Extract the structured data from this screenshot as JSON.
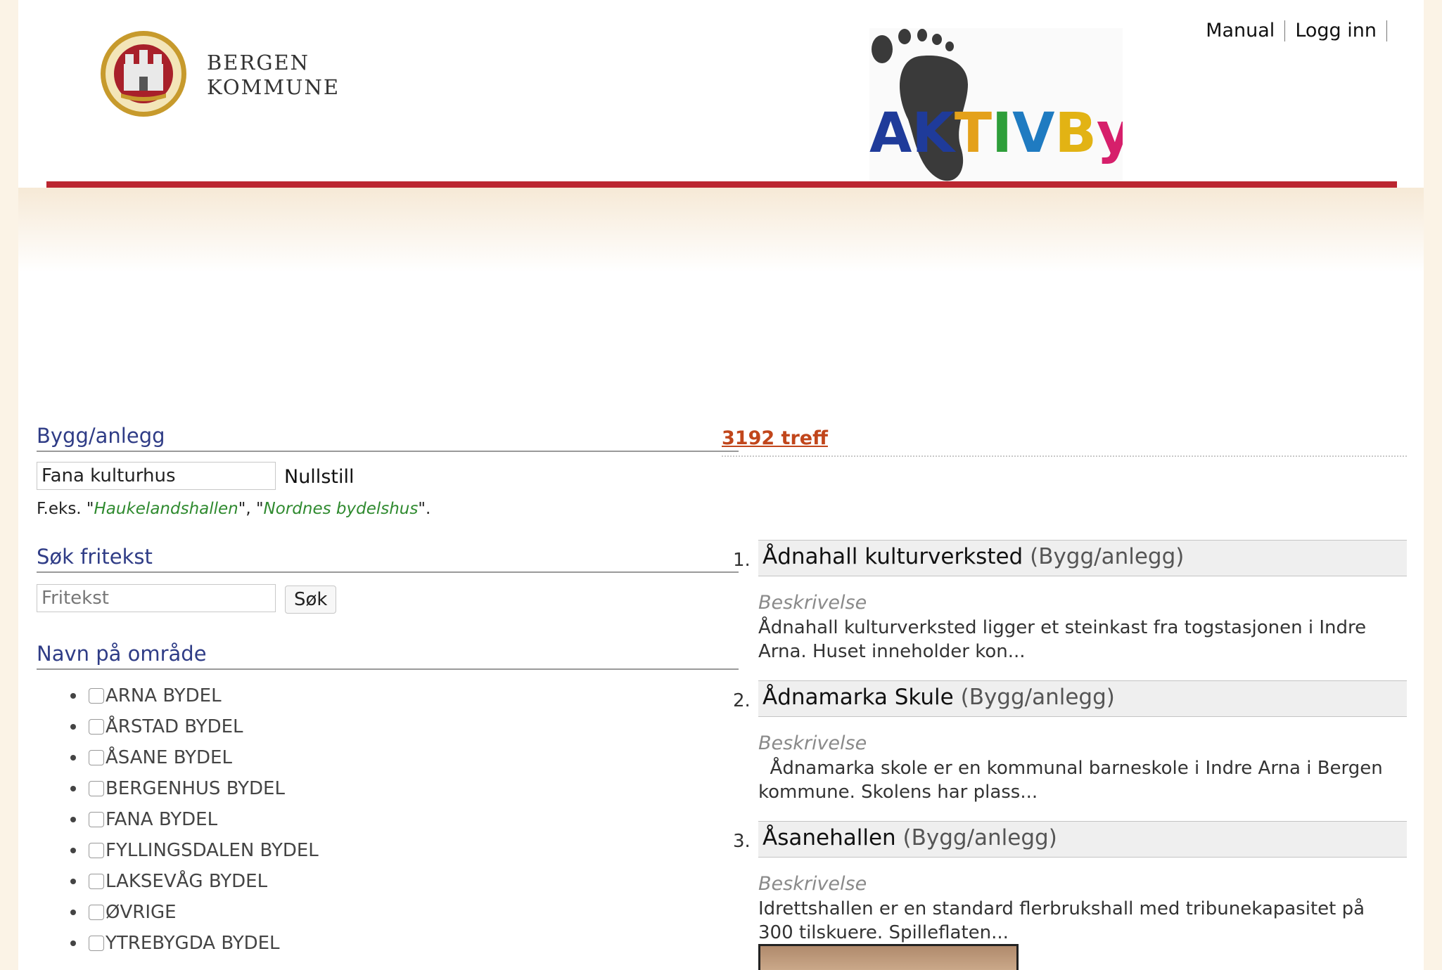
{
  "brand": {
    "line1": "BERGEN",
    "line2": "KOMMUNE",
    "logo_text": "AKTIVBY"
  },
  "topnav": {
    "manual": "Manual",
    "login": "Logg inn"
  },
  "left": {
    "bygg_heading": "Bygg/anlegg",
    "bygg_input_value": "Fana kulturhus",
    "nullstill": "Nullstill",
    "example_prefix": "F.eks. \"",
    "example_1": "Haukelandshallen",
    "example_mid": "\", \"",
    "example_2": "Nordnes bydelshus",
    "example_suffix": "\".",
    "sok_heading": "Søk fritekst",
    "fritekst_placeholder": "Fritekst",
    "sok_button": "Søk",
    "navn_heading": "Navn på område",
    "areas": [
      "ARNA BYDEL",
      "ÅRSTAD BYDEL",
      "ÅSANE BYDEL",
      "BERGENHUS BYDEL",
      "FANA BYDEL",
      "FYLLINGSDALEN BYDEL",
      "LAKSEVÅG BYDEL",
      "ØVRIGE",
      "YTREBYGDA BYDEL"
    ]
  },
  "results": {
    "count": "3192 treff",
    "items": [
      {
        "num": "1.",
        "title": "Ådnahall kulturverksted",
        "type": "(Bygg/anlegg)",
        "desc_label": "Beskrivelse",
        "desc": "Ådnahall kulturverksted ligger et steinkast fra togstasjonen i Indre Arna. Huset inneholder kon..."
      },
      {
        "num": "2.",
        "title": "Ådnamarka Skule",
        "type": "(Bygg/anlegg)",
        "desc_label": "Beskrivelse",
        "desc": "  Ådnamarka skole er en kommunal barneskole i Indre Arna i Bergen kommune. Skolens har plass..."
      },
      {
        "num": "3.",
        "title": "Åsanehallen",
        "type": "(Bygg/anlegg)",
        "desc_label": "Beskrivelse",
        "desc": "Idrettshallen er en standard flerbrukshall med tribunekapasitet på 300 tilskuere. Spilleflaten..."
      }
    ]
  },
  "colors": {
    "header_bar": "#bb2630",
    "section_heading": "#2f3c86",
    "count": "#c1461b",
    "example_link": "#2f8a2f"
  }
}
